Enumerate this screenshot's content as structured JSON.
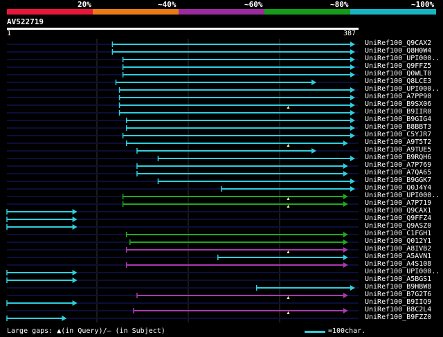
{
  "scale": {
    "labels": [
      "20%",
      "~40%",
      "~60%",
      "~80%",
      "~100%"
    ],
    "colors": [
      "#e8173a",
      "#e87b18",
      "#9b2b9e",
      "#159d19",
      "#17b5c4"
    ]
  },
  "query": {
    "name": "AV522719",
    "start": "1",
    "end": "387",
    "length": 387
  },
  "colors": {
    "cyan": "#2ecfe0",
    "green": "#1faa1f",
    "purple": "#a83ab0",
    "dark": "#0a0f3a",
    "grid": "#333333"
  },
  "hits": [
    {
      "label": "UniRef100_Q9CAX2",
      "start": 0.3,
      "end": 0.99,
      "color": "cyan",
      "gap": false
    },
    {
      "label": "UniRef100_Q8H0W4",
      "start": 0.3,
      "end": 0.99,
      "color": "cyan",
      "gap": false
    },
    {
      "label": "UniRef100_UPI000..",
      "start": 0.33,
      "end": 0.99,
      "color": "cyan",
      "gap": false
    },
    {
      "label": "UniRef100_Q9FFZ5",
      "start": 0.33,
      "end": 0.99,
      "color": "cyan",
      "gap": false
    },
    {
      "label": "UniRef100_Q0WLT0",
      "start": 0.33,
      "end": 0.99,
      "color": "cyan",
      "gap": false
    },
    {
      "label": "UniRef100_Q8LCE3",
      "start": 0.31,
      "end": 0.88,
      "color": "cyan",
      "gap": false
    },
    {
      "label": "UniRef100_UPI000..",
      "start": 0.32,
      "end": 0.99,
      "color": "cyan",
      "gap": false
    },
    {
      "label": "UniRef100_A7PP90",
      "start": 0.32,
      "end": 0.99,
      "color": "cyan",
      "gap": false
    },
    {
      "label": "UniRef100_B9SX06",
      "start": 0.32,
      "end": 0.99,
      "color": "cyan",
      "gap": true
    },
    {
      "label": "UniRef100_B9IIR0",
      "start": 0.32,
      "end": 0.99,
      "color": "cyan",
      "gap": false
    },
    {
      "label": "UniRef100_B9GIG4",
      "start": 0.34,
      "end": 0.99,
      "color": "cyan",
      "gap": false
    },
    {
      "label": "UniRef100_B8BBT3",
      "start": 0.34,
      "end": 0.99,
      "color": "cyan",
      "gap": false
    },
    {
      "label": "UniRef100_C5YJR7",
      "start": 0.33,
      "end": 0.99,
      "color": "cyan",
      "gap": false
    },
    {
      "label": "UniRef100_A9T5T2",
      "start": 0.34,
      "end": 0.97,
      "color": "cyan",
      "gap": true
    },
    {
      "label": "UniRef100_A9TUE5",
      "start": 0.37,
      "end": 0.88,
      "color": "cyan",
      "gap": false
    },
    {
      "label": "UniRef100_B9RQH6",
      "start": 0.43,
      "end": 0.99,
      "color": "cyan",
      "gap": false
    },
    {
      "label": "UniRef100_A7P769",
      "start": 0.37,
      "end": 0.97,
      "color": "cyan",
      "gap": false
    },
    {
      "label": "UniRef100_A7QA65",
      "start": 0.37,
      "end": 0.97,
      "color": "cyan",
      "gap": false
    },
    {
      "label": "UniRef100_B9GGK7",
      "start": 0.43,
      "end": 0.99,
      "color": "cyan",
      "gap": false
    },
    {
      "label": "UniRef100_Q0J4Y4",
      "start": 0.61,
      "end": 0.99,
      "color": "cyan",
      "gap": false
    },
    {
      "label": "UniRef100_UPI000..",
      "start": 0.33,
      "end": 0.97,
      "color": "green",
      "gap": true
    },
    {
      "label": "UniRef100_A7P719",
      "start": 0.33,
      "end": 0.97,
      "color": "green",
      "gap": true
    },
    {
      "label": "UniRef100_Q9CAX1",
      "start": 0.0,
      "end": 0.2,
      "color": "cyan",
      "gap": false
    },
    {
      "label": "UniRef100_Q9FFZ4",
      "start": 0.0,
      "end": 0.2,
      "color": "cyan",
      "gap": false
    },
    {
      "label": "UniRef100_Q9ASZ0",
      "start": 0.0,
      "end": 0.2,
      "color": "cyan",
      "gap": false
    },
    {
      "label": "UniRef100_C1FGH1",
      "start": 0.34,
      "end": 0.97,
      "color": "green",
      "gap": false
    },
    {
      "label": "UniRef100_Q012Y1",
      "start": 0.35,
      "end": 0.97,
      "color": "green",
      "gap": false
    },
    {
      "label": "UniRef100_A8IVB2",
      "start": 0.34,
      "end": 0.97,
      "color": "purple",
      "gap": true
    },
    {
      "label": "UniRef100_A5AVN1",
      "start": 0.6,
      "end": 0.97,
      "color": "cyan",
      "gap": false
    },
    {
      "label": "UniRef100_A4S108",
      "start": 0.34,
      "end": 0.97,
      "color": "purple",
      "gap": false
    },
    {
      "label": "UniRef100_UPI000..",
      "start": 0.0,
      "end": 0.2,
      "color": "cyan",
      "gap": false
    },
    {
      "label": "UniRef100_A5BGS1",
      "start": 0.0,
      "end": 0.2,
      "color": "cyan",
      "gap": false
    },
    {
      "label": "UniRef100_B9HBW8",
      "start": 0.71,
      "end": 0.99,
      "color": "cyan",
      "gap": false
    },
    {
      "label": "UniRef100_B7G2T6",
      "start": 0.37,
      "end": 0.97,
      "color": "purple",
      "gap": true
    },
    {
      "label": "UniRef100_B9IIQ9",
      "start": 0.0,
      "end": 0.2,
      "color": "cyan",
      "gap": false
    },
    {
      "label": "UniRef100_B8C2L4",
      "start": 0.36,
      "end": 0.97,
      "color": "purple",
      "gap": true
    },
    {
      "label": "UniRef100_B9FZZ0",
      "start": 0.0,
      "end": 0.17,
      "color": "cyan",
      "gap": false
    }
  ],
  "footer": {
    "text": "Large gaps: ▲(in Query)/– (in Subject)",
    "legend": "=100char."
  }
}
